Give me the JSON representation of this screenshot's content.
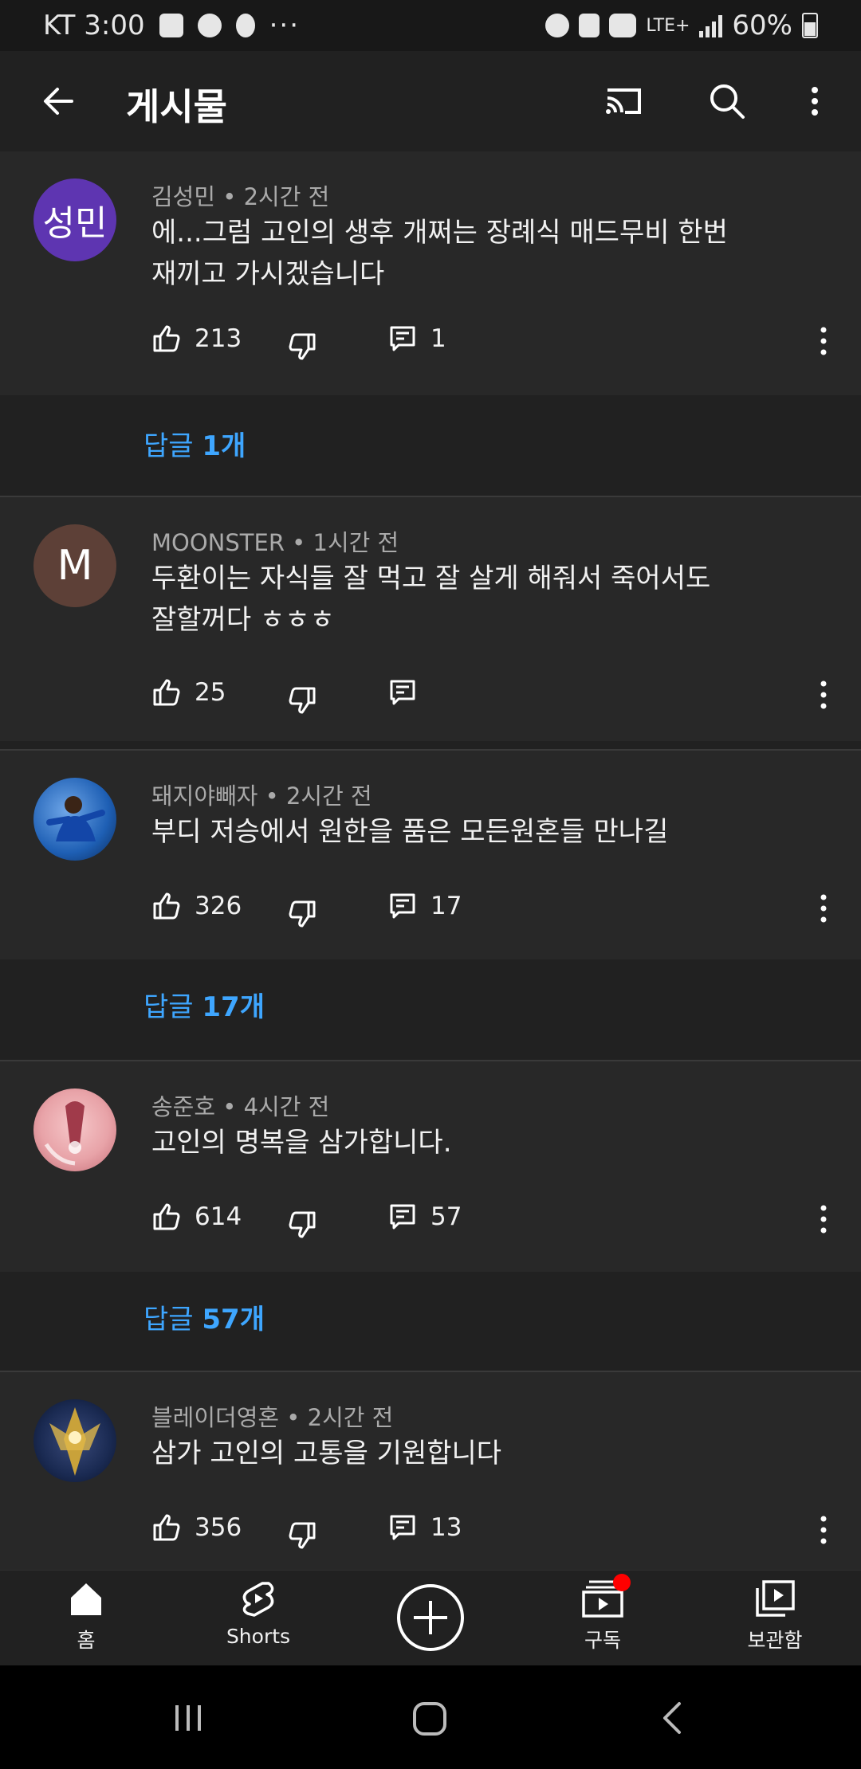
{
  "status_bar": {
    "carrier_time": "KT 3:00",
    "dots": "···",
    "network": "LTE+",
    "battery": "60%"
  },
  "app_bar": {
    "title": "게시물"
  },
  "comments": [
    {
      "avatar_text": "성민",
      "avatar_color": "#5e35b1",
      "author": "김성민",
      "time": "2시간 전",
      "text_line1": "에...그럼 고인의 생후 개쩌는 장례식 매드무비 한번",
      "text_line2": "재끼고 가시겠습니다",
      "likes": "213",
      "replies": "1",
      "reply_prefix": "답글 ",
      "reply_count": "1개"
    },
    {
      "avatar_text": "M",
      "avatar_color": "#5d4037",
      "author": "MOONSTER",
      "time": "1시간 전",
      "text_line1": "두환이는 자식들 잘 먹고 잘 살게 해줘서 죽어서도",
      "text_line2": "잘할꺼다 ㅎㅎㅎ",
      "likes": "25",
      "replies": ""
    },
    {
      "avatar_color": "#1e5fb4",
      "author": "돼지야빼자",
      "time": "2시간 전",
      "text_line1": "부디 저승에서 원한을 품은 모든원혼들 만나길",
      "likes": "326",
      "replies": "17",
      "reply_prefix": "답글 ",
      "reply_count": "17개"
    },
    {
      "avatar_color": "#e8a3a8",
      "author": "송준호",
      "time": "4시간 전",
      "text_line1": "고인의 명복을 삼가합니다.",
      "likes": "614",
      "replies": "57",
      "reply_prefix": "답글 ",
      "reply_count": "57개"
    },
    {
      "avatar_color": "#1a2a52",
      "author": "블레이더영혼",
      "time": "2시간 전",
      "text_line1": "삼가 고인의 고통을 기원합니다",
      "likes": "356",
      "replies": "13"
    }
  ],
  "bottom_nav": {
    "home": "홈",
    "shorts": "Shorts",
    "subscriptions": "구독",
    "library": "보관함"
  },
  "colors": {
    "accent_link": "#3ea6ff",
    "notification_dot": "#ff0000"
  }
}
